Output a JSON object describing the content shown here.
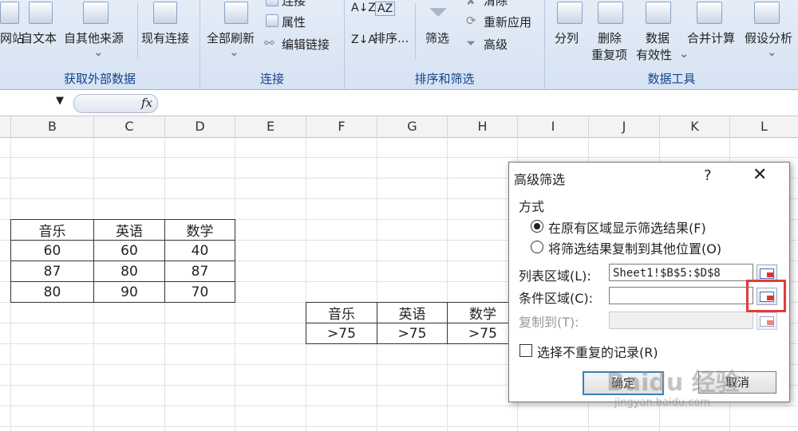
{
  "ribbon": {
    "groups": [
      {
        "label": "获取外部数据"
      },
      {
        "label": "连接"
      },
      {
        "label": "排序和筛选"
      },
      {
        "label": "数据工具"
      }
    ],
    "buttons": {
      "web": "网站",
      "text": "自文本",
      "other": "自其他来源",
      "existing": "现有连接",
      "refresh_all": "全部刷新",
      "connections": "连接",
      "properties": "属性",
      "edit_links": "编辑链接",
      "sort": "排序...",
      "filter": "筛选",
      "clear": "清除",
      "reapply": "重新应用",
      "advanced": "高级",
      "split": "分列",
      "remove_dup_1": "删除",
      "remove_dup_2": "重复项",
      "validation_1": "数据",
      "validation_2": "有效性",
      "consolidate": "合并计算",
      "whatif": "假设分析"
    }
  },
  "formula_bar": {
    "fx": "fx"
  },
  "columns": [
    "B",
    "C",
    "D",
    "E",
    "F",
    "G",
    "H",
    "I",
    "J",
    "K",
    "L"
  ],
  "table1": {
    "headers": [
      "音乐",
      "英语",
      "数学"
    ],
    "rows": [
      [
        "60",
        "60",
        "40"
      ],
      [
        "87",
        "80",
        "87"
      ],
      [
        "80",
        "90",
        "70"
      ]
    ]
  },
  "table2": {
    "headers": [
      "音乐",
      "英语",
      "数学"
    ],
    "row": [
      ">75",
      ">75",
      ">75"
    ]
  },
  "dialog": {
    "title": "高级筛选",
    "help": "?",
    "close": "✕",
    "mode_label": "方式",
    "option1": "在原有区域显示筛选结果(F)",
    "option2": "将筛选结果复制到其他位置(O)",
    "list_range_label": "列表区域(L):",
    "list_range_value": "Sheet1!$B$5:$D$8",
    "criteria_label": "条件区域(C):",
    "criteria_value": "",
    "copy_to_label": "复制到(T):",
    "unique_label": "选择不重复的记录(R)",
    "ok": "确定",
    "cancel": "取消"
  },
  "watermark": {
    "brand": "Baidu 经验",
    "url": "jingyan.baidu.com"
  }
}
